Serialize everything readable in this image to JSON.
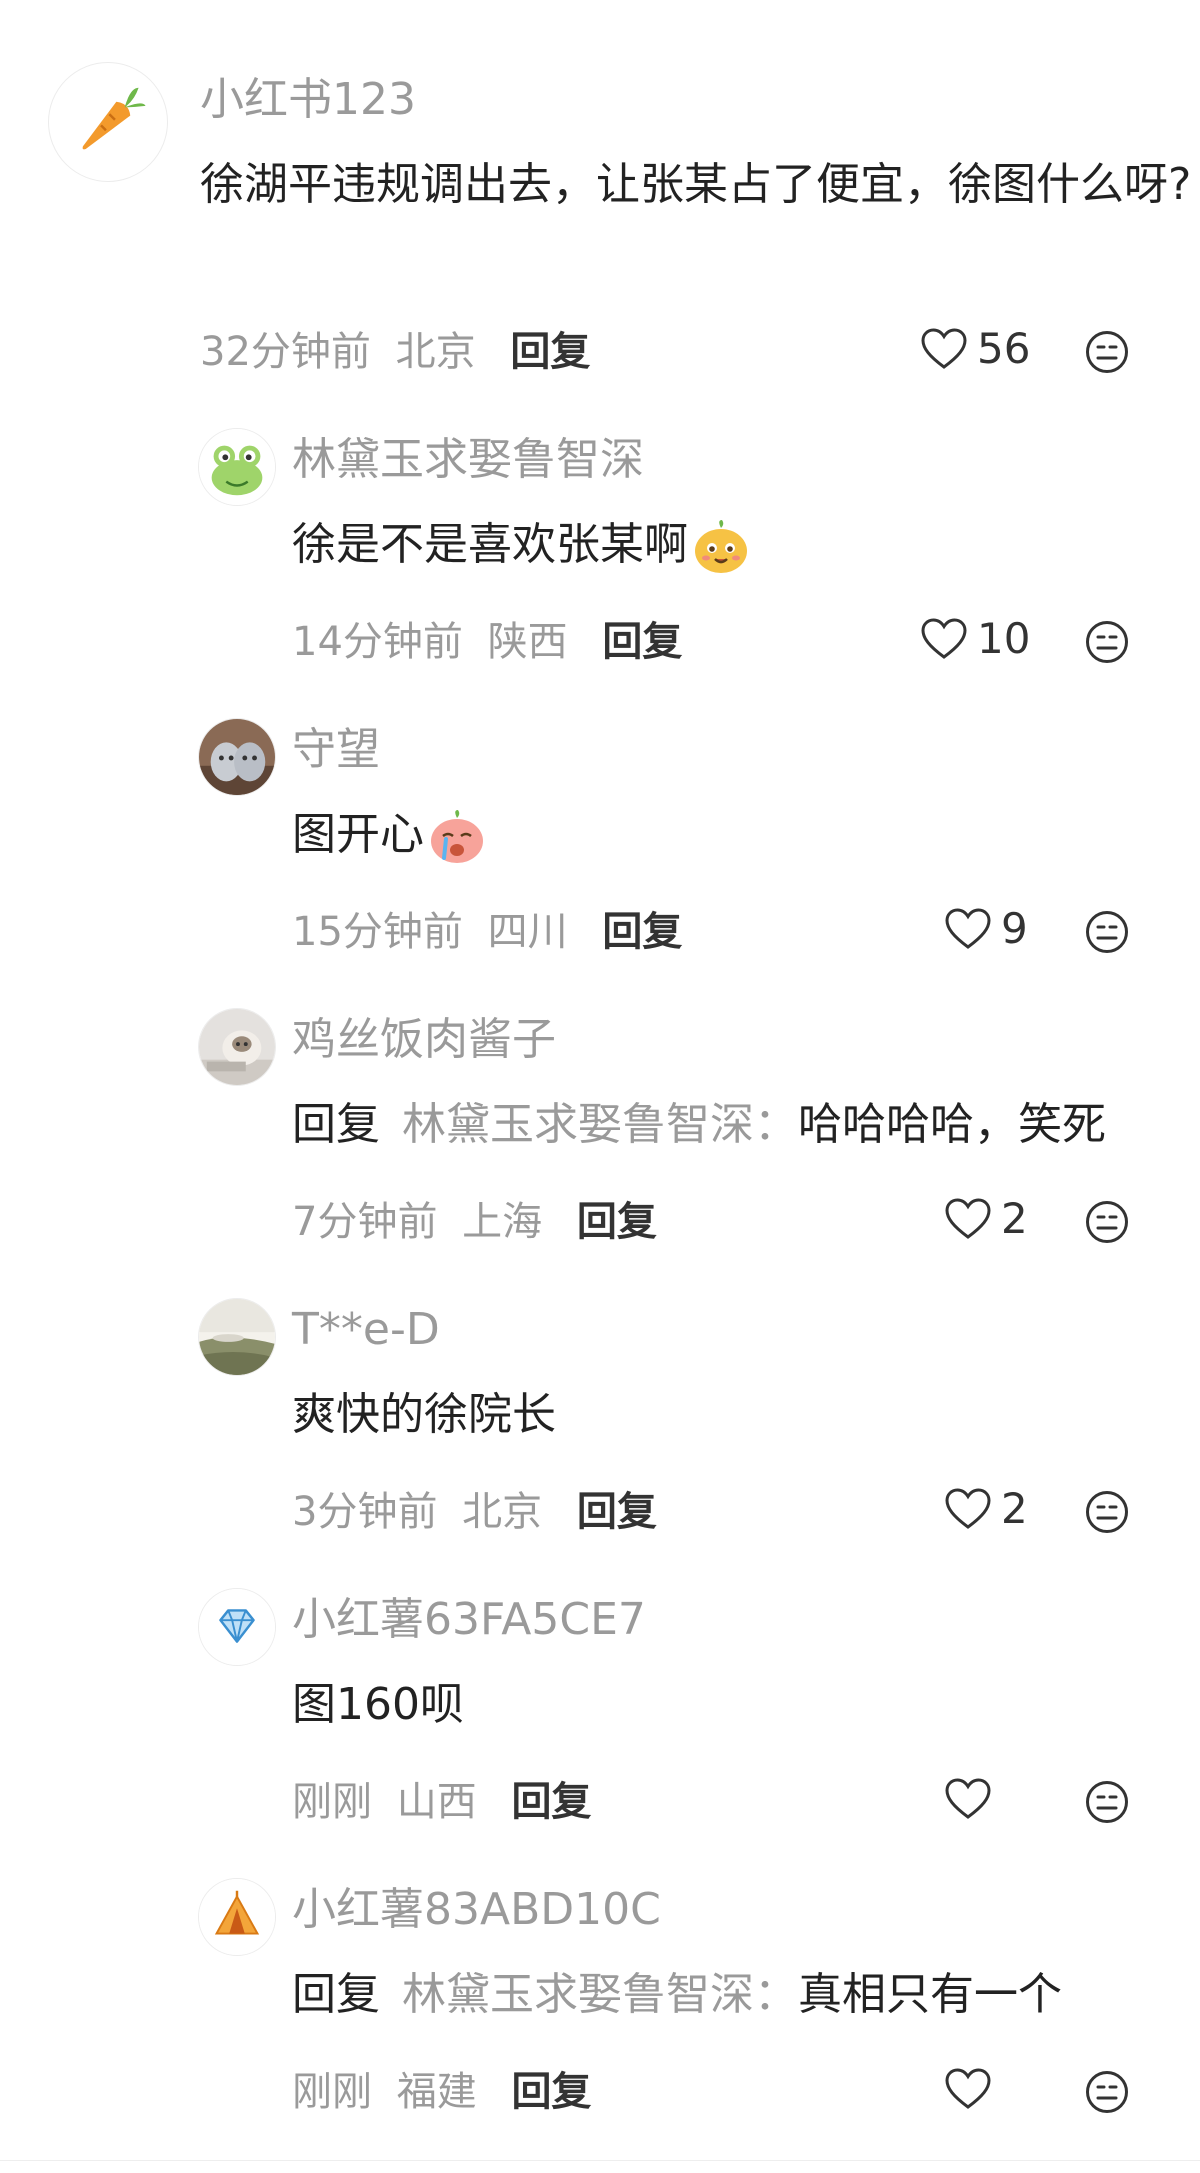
{
  "comments": [
    {
      "username": "小红书123",
      "text": "徐湖平违规调出去，让张某占了便宜，徐图什么呀?",
      "time": "32分钟前",
      "location": "北京",
      "reply_label": "回复",
      "likes": "56",
      "avatar_icon": "carrot-icon"
    },
    {
      "username": "林黛玉求娶鲁智深",
      "text": "徐是不是喜欢张某啊",
      "sticker": "smile-sticker-icon",
      "time": "14分钟前",
      "location": "陕西",
      "reply_label": "回复",
      "likes": "10",
      "avatar_icon": "frog-icon"
    },
    {
      "username": "守望",
      "text": "图开心",
      "sticker": "crying-sticker-icon",
      "time": "15分钟前",
      "location": "四川",
      "reply_label": "回复",
      "likes": "9",
      "avatar_icon": "cats-photo"
    },
    {
      "username": "鸡丝饭肉酱子",
      "reply_prefix": "回复",
      "mention": "林黛玉求娶鲁智深：",
      "text": "哈哈哈哈，笑死",
      "time": "7分钟前",
      "location": "上海",
      "reply_label": "回复",
      "likes": "2",
      "avatar_icon": "cat-photo"
    },
    {
      "username": "T**e-D",
      "text": "爽快的徐院长",
      "time": "3分钟前",
      "location": "北京",
      "reply_label": "回复",
      "likes": "2",
      "avatar_icon": "landscape-photo"
    },
    {
      "username": "小红薯63FA5CE7",
      "text": "图160呗",
      "time": "刚刚",
      "location": "山西",
      "reply_label": "回复",
      "likes": "",
      "avatar_icon": "diamond-icon"
    },
    {
      "username": "小红薯83ABD10C",
      "reply_prefix": "回复",
      "mention": "林黛玉求娶鲁智深：",
      "text": "真相只有一个",
      "time": "刚刚",
      "location": "福建",
      "reply_label": "回复",
      "likes": "",
      "avatar_icon": "tent-icon"
    }
  ],
  "colors": {
    "username": "#9a9a9a",
    "text": "#222222",
    "meta": "#9a9a9a",
    "icon": "#333333"
  }
}
